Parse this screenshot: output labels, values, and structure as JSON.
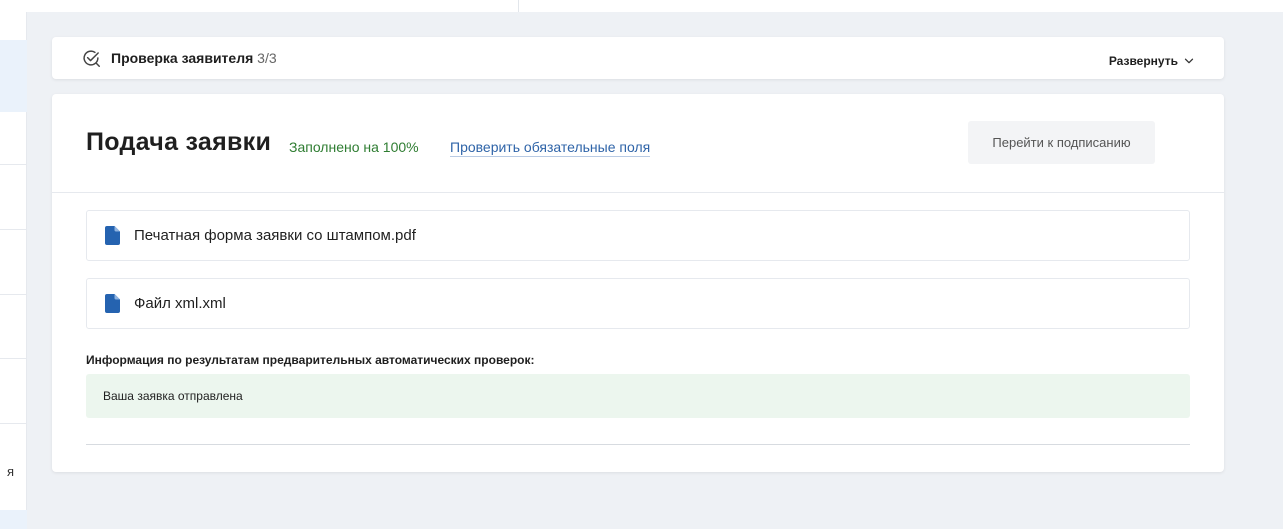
{
  "sidebar": {
    "partial_letter": "я"
  },
  "applicant_check": {
    "title": "Проверка заявителя",
    "count": "3/3",
    "expand_label": "Развернуть"
  },
  "submission": {
    "title": "Подача заявки",
    "fill_status": "Заполнено на 100%",
    "check_fields_link": "Проверить обязательные поля",
    "sign_button": "Перейти к подписанию",
    "files": [
      {
        "name": "Печатная форма заявки со штампом.pdf",
        "icon": "document-icon"
      },
      {
        "name": "Файл xml.xml",
        "icon": "document-icon"
      }
    ],
    "info_label": "Информация по результатам предварительных автоматических проверок:",
    "info_message": "Ваша заявка отправлена"
  },
  "colors": {
    "accent_blue": "#2f64a8",
    "status_green": "#2f7d32",
    "file_icon": "#2563b0",
    "info_bg": "#ecf6ee"
  }
}
